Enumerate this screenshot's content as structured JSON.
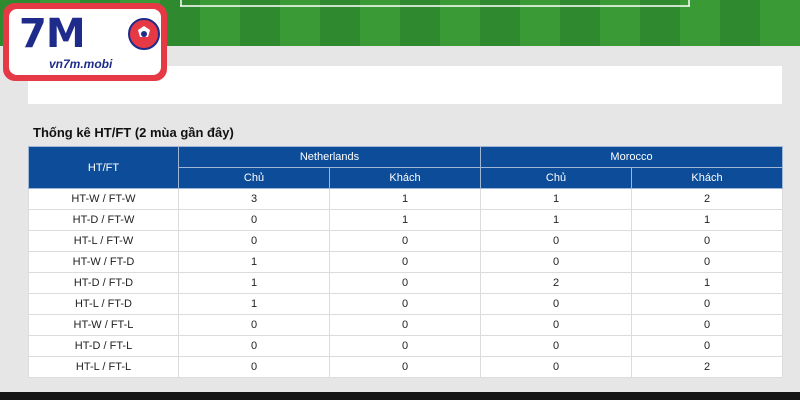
{
  "logo": {
    "mark": "7M",
    "url": "vn7m.mobi"
  },
  "section": {
    "title": "Thống kê HT/FT (2 mùa gần đây)"
  },
  "table": {
    "row_header": "HT/FT",
    "teams": [
      "Netherlands",
      "Morocco"
    ],
    "subheaders": [
      "Chủ",
      "Khách",
      "Chủ",
      "Khách"
    ],
    "rows": [
      {
        "label": "HT-W / FT-W",
        "values": [
          "3",
          "1",
          "1",
          "2"
        ]
      },
      {
        "label": "HT-D / FT-W",
        "values": [
          "0",
          "1",
          "1",
          "1"
        ]
      },
      {
        "label": "HT-L / FT-W",
        "values": [
          "0",
          "0",
          "0",
          "0"
        ]
      },
      {
        "label": "HT-W / FT-D",
        "values": [
          "1",
          "0",
          "0",
          "0"
        ]
      },
      {
        "label": "HT-D / FT-D",
        "values": [
          "1",
          "0",
          "2",
          "1"
        ]
      },
      {
        "label": "HT-L / FT-D",
        "values": [
          "1",
          "0",
          "0",
          "0"
        ]
      },
      {
        "label": "HT-W / FT-L",
        "values": [
          "0",
          "0",
          "0",
          "0"
        ]
      },
      {
        "label": "HT-D / FT-L",
        "values": [
          "0",
          "0",
          "0",
          "0"
        ]
      },
      {
        "label": "HT-L / FT-L",
        "values": [
          "0",
          "0",
          "0",
          "2"
        ]
      }
    ]
  },
  "colors": {
    "header_blue": "#0d4c99",
    "logo_red": "#e63946",
    "logo_navy": "#1e2b8a"
  }
}
